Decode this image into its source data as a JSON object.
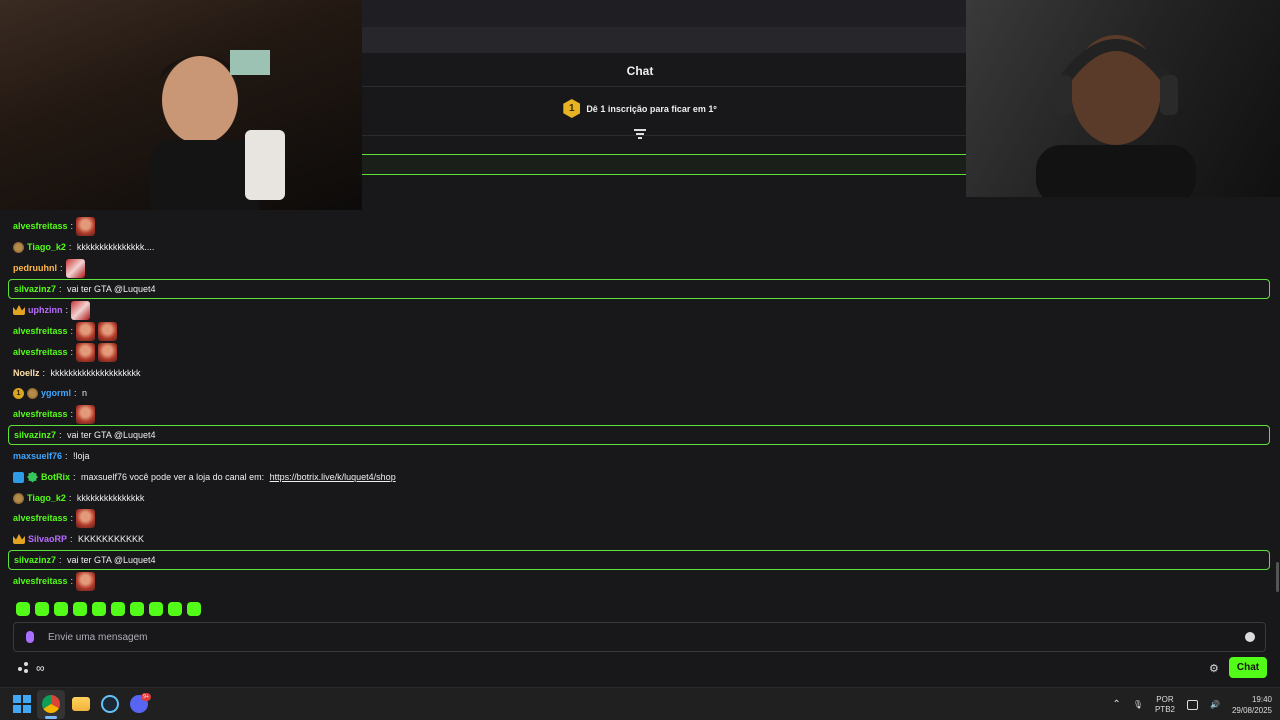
{
  "chat": {
    "title": "Chat",
    "leaderboard_rank": "1",
    "leaderboard_text": "Dê 1 inscrição para ficar em 1º",
    "input_placeholder": "Envie uma mensagem",
    "send_label": "Chat",
    "infinity": "∞"
  },
  "messages": [
    {
      "user": "alvesfreitass",
      "text": "",
      "color": "#53fc18",
      "emotes": 1,
      "emote": "cross"
    },
    {
      "user": "Tiago_k2",
      "text": " kkkkkkkkkkkkkkk....",
      "color": "#53fc18",
      "badges": [
        "sub"
      ]
    },
    {
      "user": "pedruuhnl",
      "text": "",
      "color": "#ffb74a",
      "emotes": 1,
      "emote": "flag"
    },
    {
      "user": "silvazinz7",
      "text": " vai ter GTA @Luquet4",
      "color": "#53fc18",
      "highlight": true
    },
    {
      "user": "uphzinn",
      "text": "",
      "color": "#b96bff",
      "badges": [
        "crown"
      ],
      "emotes": 1,
      "emote": "flag"
    },
    {
      "user": "alvesfreitass",
      "text": "",
      "color": "#53fc18",
      "emotes": 2,
      "emote": "cross"
    },
    {
      "user": "alvesfreitass",
      "text": "",
      "color": "#53fc18",
      "emotes": 2,
      "emote": "cross"
    },
    {
      "user": "Noellz",
      "text": " kkkkkkkkkkkkkkkkkkkk",
      "color": "#ffe0a8"
    },
    {
      "user": "ygorml",
      "text": " n",
      "color": "#3ea6ff",
      "badges": [
        "gold",
        "sub"
      ]
    },
    {
      "user": "alvesfreitass",
      "text": "",
      "color": "#53fc18",
      "emotes": 1,
      "emote": "cross"
    },
    {
      "user": "silvazinz7",
      "text": " vai ter GTA @Luquet4",
      "color": "#53fc18",
      "highlight": true
    },
    {
      "user": "maxsuelf76",
      "text": " !loja",
      "color": "#3ea6ff"
    },
    {
      "user": "BotRix",
      "text": " maxsuelf76 você pode ver a loja do canal em: ",
      "link": "https://botrix.live/k/luquet4/shop",
      "color": "#53fc18",
      "badges": [
        "bot",
        "verified"
      ]
    },
    {
      "user": "Tiago_k2",
      "text": " kkkkkkkkkkkkkkk",
      "color": "#53fc18",
      "badges": [
        "sub"
      ]
    },
    {
      "user": "alvesfreitass",
      "text": "",
      "color": "#53fc18",
      "emotes": 1,
      "emote": "cross"
    },
    {
      "user": "SilvaoRP",
      "text": " KKKKKKKKKKK",
      "color": "#b96bff",
      "badges": [
        "crown"
      ]
    },
    {
      "user": "silvazinz7",
      "text": " vai ter GTA @Luquet4",
      "color": "#53fc18",
      "highlight": true
    },
    {
      "user": "alvesfreitass",
      "text": "",
      "color": "#53fc18",
      "emotes": 1,
      "emote": "cross"
    }
  ],
  "taskbar": {
    "language_top": "POR",
    "language_bottom": "PTB2",
    "time": "19:40",
    "date": "29/08/2025",
    "discord_badge": "9+"
  },
  "colors": {
    "accent": "#53fc18",
    "background": "#18181b"
  }
}
